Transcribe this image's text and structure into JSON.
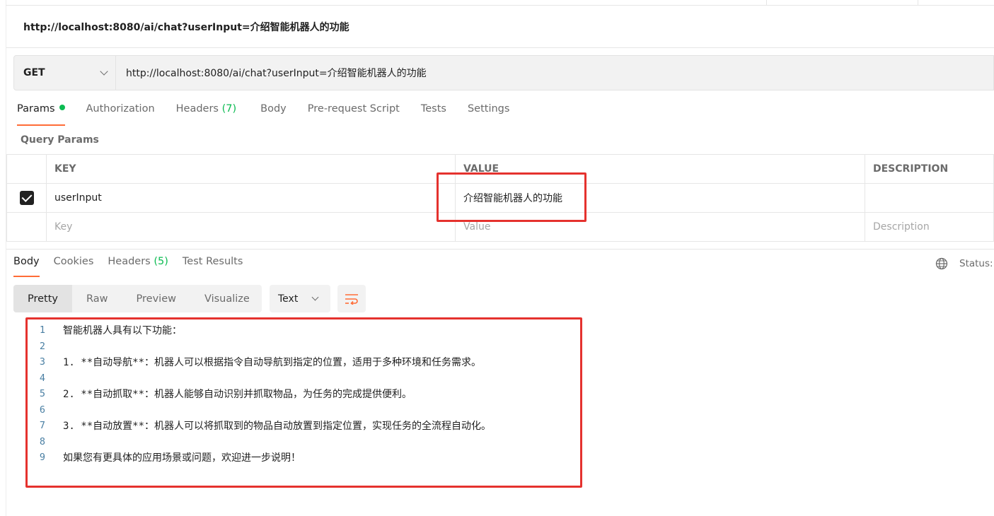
{
  "request": {
    "title": "http://localhost:8080/ai/chat?userInput=介绍智能机器人的功能",
    "method": "GET",
    "url": "http://localhost:8080/ai/chat?userInput=介绍智能机器人的功能"
  },
  "request_tabs": [
    {
      "label": "Params",
      "count": ""
    },
    {
      "label": "Authorization",
      "count": ""
    },
    {
      "label": "Headers",
      "count": "(7)"
    },
    {
      "label": "Body",
      "count": ""
    },
    {
      "label": "Pre-request Script",
      "count": ""
    },
    {
      "label": "Tests",
      "count": ""
    },
    {
      "label": "Settings",
      "count": ""
    }
  ],
  "query_params": {
    "label": "Query Params",
    "headers": {
      "key": "KEY",
      "value": "VALUE",
      "description": "DESCRIPTION"
    },
    "rows": [
      {
        "checked": true,
        "key": "userInput",
        "value": "介绍智能机器人的功能",
        "description": ""
      }
    ],
    "placeholders": {
      "key": "Key",
      "value": "Value",
      "description": "Description"
    }
  },
  "response_tabs": [
    {
      "label": "Body",
      "count": ""
    },
    {
      "label": "Cookies",
      "count": ""
    },
    {
      "label": "Headers",
      "count": "(5)"
    },
    {
      "label": "Test Results",
      "count": ""
    }
  ],
  "status_label": "Status:",
  "view_modes": [
    "Pretty",
    "Raw",
    "Preview",
    "Visualize"
  ],
  "format": "Text",
  "response_lines": [
    {
      "n": "1",
      "text": "智能机器人具有以下功能："
    },
    {
      "n": "2",
      "text": ""
    },
    {
      "n": "3",
      "text": "1. **自动导航**：机器人可以根据指令自动导航到指定的位置，适用于多种环境和任务需求。"
    },
    {
      "n": "4",
      "text": ""
    },
    {
      "n": "5",
      "text": "2. **自动抓取**：机器人能够自动识别并抓取物品，为任务的完成提供便利。"
    },
    {
      "n": "6",
      "text": ""
    },
    {
      "n": "7",
      "text": "3. **自动放置**：机器人可以将抓取到的物品自动放置到指定位置，实现任务的全流程自动化。"
    },
    {
      "n": "8",
      "text": ""
    },
    {
      "n": "9",
      "text": "如果您有更具体的应用场景或问题，欢迎进一步说明！"
    }
  ],
  "colors": {
    "accent": "#ff6c37",
    "success": "#0cbb52",
    "highlight": "#e5322e"
  }
}
